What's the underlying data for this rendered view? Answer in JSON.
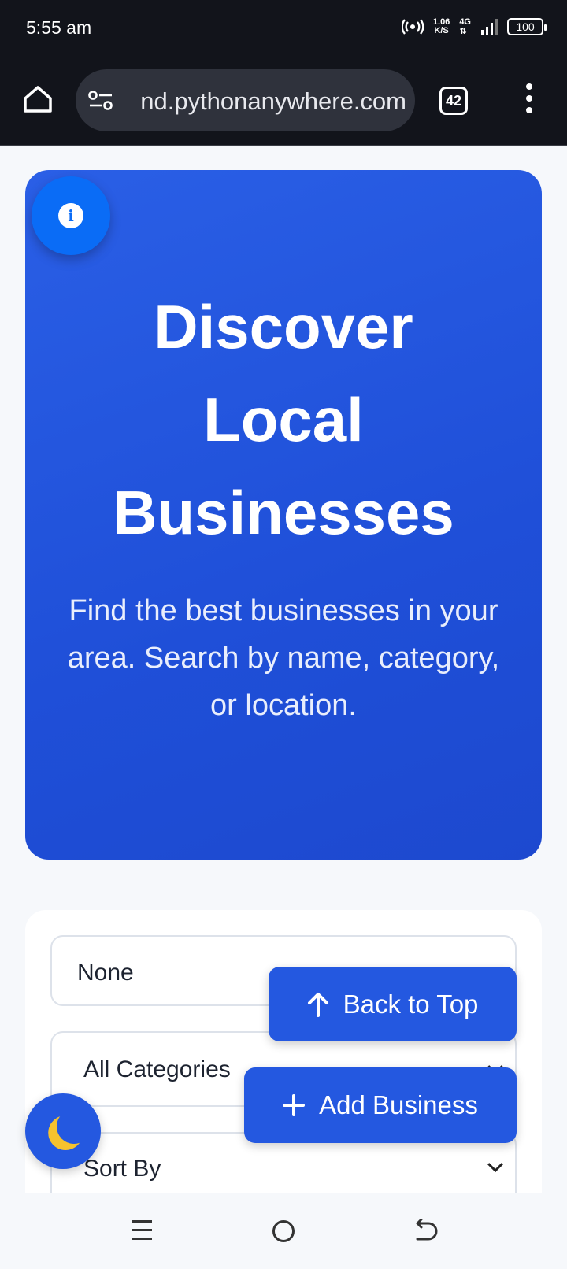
{
  "status": {
    "time": "5:55 am",
    "speed_value": "1.06",
    "speed_unit": "K/S",
    "network": "4G",
    "battery": "100"
  },
  "browser": {
    "url": "nd.pythonanywhere.com",
    "tab_count": "42"
  },
  "hero": {
    "title_line1": "Discover",
    "title_line2": "Local",
    "title_line3": "Businesses",
    "subtitle": "Find the best businesses in your area. Search by name, category, or location."
  },
  "filters": {
    "search_value": "None",
    "category_selected": "All Categories",
    "sort_selected": "Sort By"
  },
  "buttons": {
    "back_to_top": "Back to Top",
    "add_business": "Add Business"
  },
  "icons": {
    "info": "info-icon",
    "home": "home-icon",
    "tune": "tune-icon",
    "menu": "more-vert-icon",
    "arrow_up": "arrow-up-icon",
    "plus": "plus-icon",
    "moon": "moon-icon",
    "nav_menu": "recents-icon",
    "nav_home": "nav-home-icon",
    "nav_back": "nav-back-icon"
  },
  "colors": {
    "primary": "#2458e0",
    "info_fab": "#0a6cf6",
    "status_bar": "#12141b",
    "moon": "#f5c22e"
  }
}
